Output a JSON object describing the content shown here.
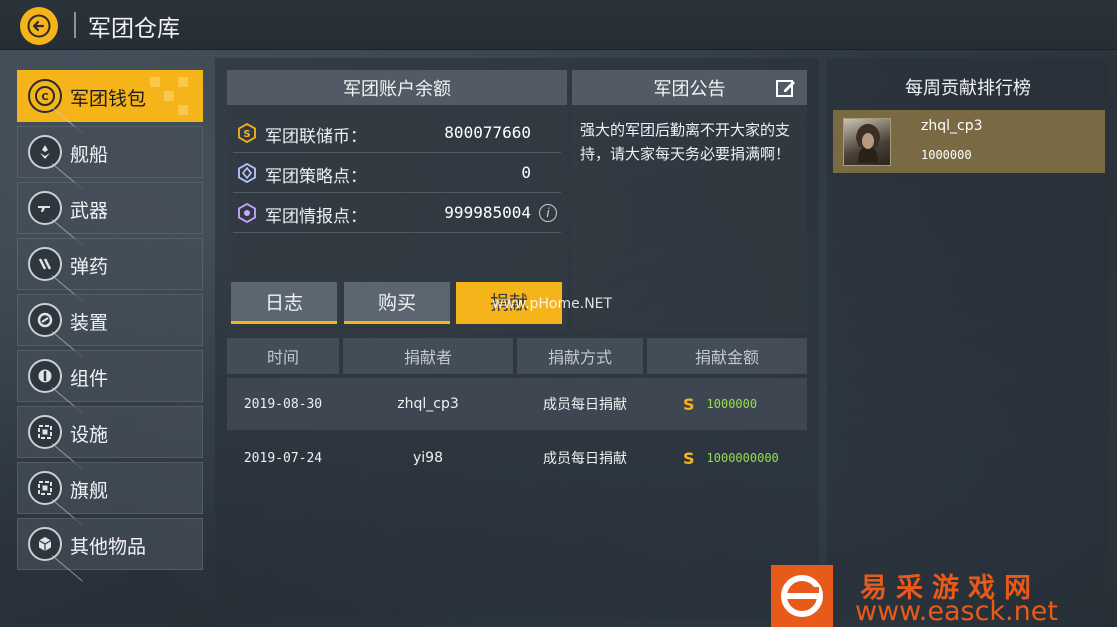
{
  "header": {
    "title": "军团仓库"
  },
  "nav": [
    {
      "label": "军团钱包",
      "icon": "wallet-icon",
      "active": true
    },
    {
      "label": "舰船",
      "icon": "ship-icon",
      "active": false
    },
    {
      "label": "武器",
      "icon": "gun-icon",
      "active": false
    },
    {
      "label": "弹药",
      "icon": "ammo-icon",
      "active": false
    },
    {
      "label": "装置",
      "icon": "device-icon",
      "active": false
    },
    {
      "label": "组件",
      "icon": "component-icon",
      "active": false
    },
    {
      "label": "设施",
      "icon": "facility-icon",
      "active": false
    },
    {
      "label": "旗舰",
      "icon": "flagship-icon",
      "active": false
    },
    {
      "label": "其他物品",
      "icon": "box-icon",
      "active": false
    }
  ],
  "balance": {
    "title": "军团账户余额",
    "rows": [
      {
        "label": "军团联储币：",
        "value": "800077660",
        "icon": "coin-s-icon"
      },
      {
        "label": "军团策略点：",
        "value": "0",
        "icon": "strategy-icon"
      },
      {
        "label": "军团情报点：",
        "value": "999985004",
        "icon": "intel-icon",
        "info": "i"
      }
    ]
  },
  "buttons": {
    "log": "日志",
    "buy": "购买",
    "donate": "捐献"
  },
  "notice": {
    "title": "军团公告",
    "text": "强大的军团后勤离不开大家的支持，请大家每天务必要捐满啊！"
  },
  "table": {
    "headers": [
      "时间",
      "捐献者",
      "捐献方式",
      "捐献金额"
    ],
    "rows": [
      {
        "date": "2019-08-30",
        "donor": "zhql_cp3",
        "method": "成员每日捐献",
        "amount": "1000000"
      },
      {
        "date": "2019-07-24",
        "donor": "yi98",
        "method": "成员每日捐献",
        "amount": "1000000000"
      }
    ],
    "currency_symbol": "S"
  },
  "ranking": {
    "title": "每周贡献排行榜",
    "entries": [
      {
        "name": "zhql_cp3",
        "value": "1000000"
      }
    ]
  },
  "watermarks": {
    "center": "www.pHome.NET",
    "logo_cn": "易采游戏网",
    "logo_url": "www.easck.net"
  },
  "colors": {
    "accent": "#f5b51a",
    "amount": "#94e04a",
    "ranking_highlight": "#7a6a44",
    "logo": "#e85a1a"
  }
}
